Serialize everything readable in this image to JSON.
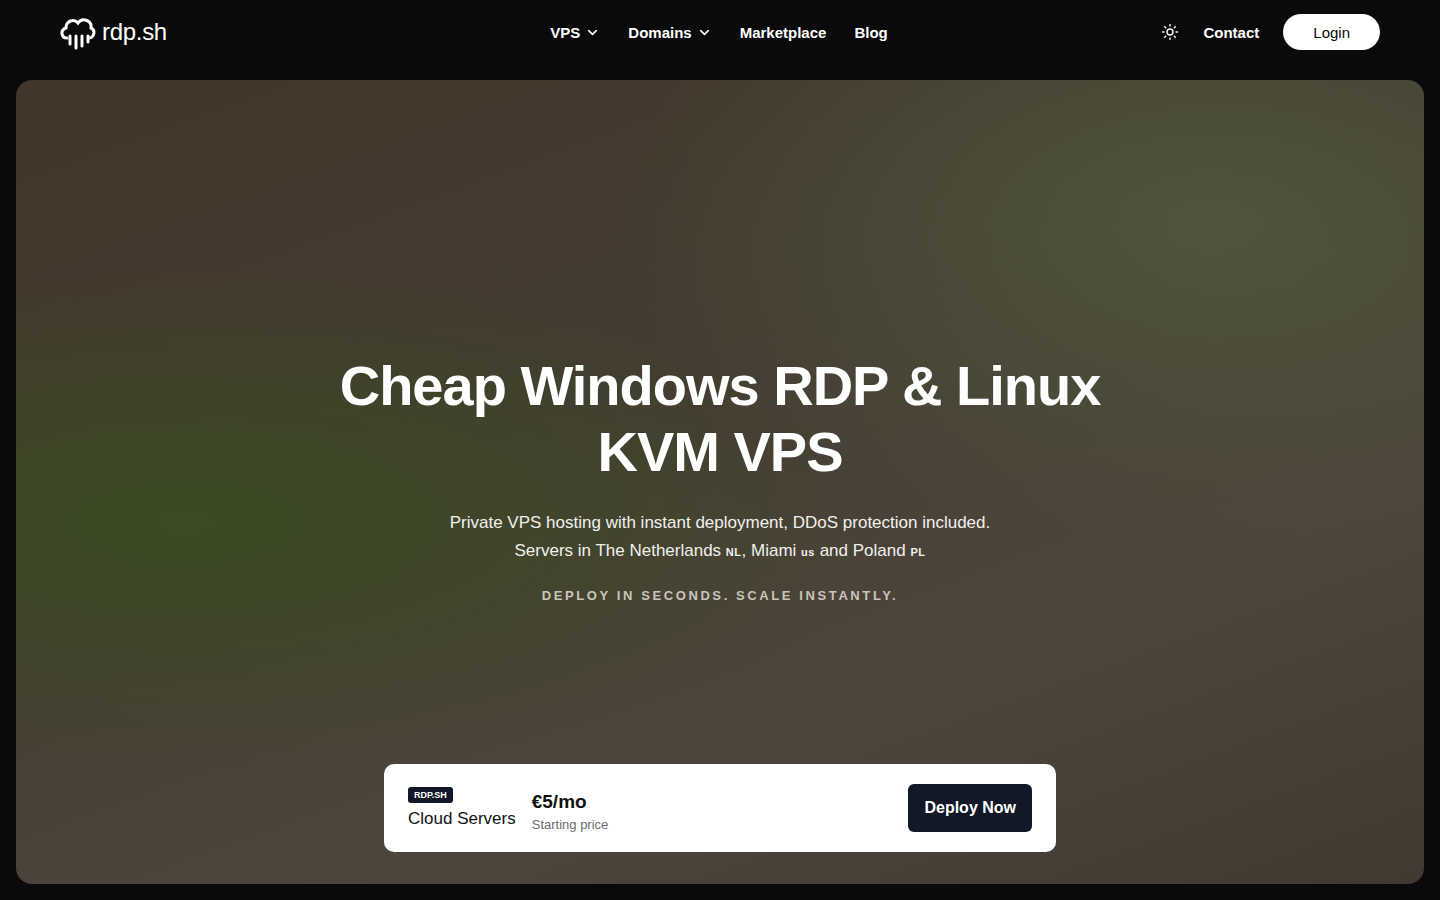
{
  "header": {
    "logo": "rdp.sh",
    "nav": [
      {
        "label": "VPS",
        "dropdown": true
      },
      {
        "label": "Domains",
        "dropdown": true
      },
      {
        "label": "Marketplace",
        "dropdown": false
      },
      {
        "label": "Blog",
        "dropdown": false
      }
    ],
    "contact": "Contact",
    "login": "Login"
  },
  "hero": {
    "title": "Cheap Windows RDP & Linux KVM VPS",
    "subtitle": "Private VPS hosting with instant deployment, DDoS protection included.",
    "locations_prefix": "Servers in",
    "locations": [
      {
        "name": "The Netherlands",
        "flag": "NL",
        "suffix": ","
      },
      {
        "name": "Miami",
        "flag": "us",
        "suffix": " and"
      },
      {
        "name": "Poland",
        "flag": "PL",
        "suffix": ""
      }
    ],
    "tagline": "DEPLOY IN SECONDS. SCALE INSTANTLY."
  },
  "offer": {
    "badge": "RDP.SH",
    "product": "Cloud Servers",
    "price": "€5/mo",
    "price_label": "Starting price",
    "button": "Deploy Now"
  }
}
